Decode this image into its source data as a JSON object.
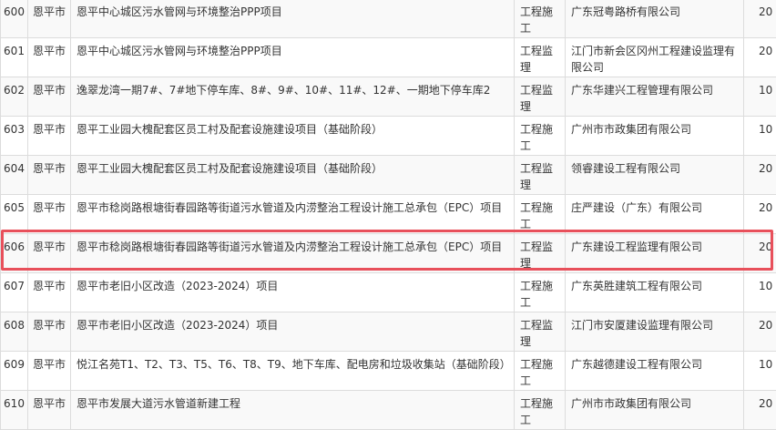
{
  "table": {
    "rows": [
      {
        "num": "600",
        "city": "恩平市",
        "project": "恩平中心城区污水管网与环境整治PPP项目",
        "type": "工程施工",
        "company": "广东冠粤路桥有限公司",
        "score": "20"
      },
      {
        "num": "601",
        "city": "恩平市",
        "project": "恩平中心城区污水管网与环境整治PPP项目",
        "type": "工程监理",
        "company": "江门市新会区冈州工程建设监理有限公司",
        "score": "20"
      },
      {
        "num": "602",
        "city": "恩平市",
        "project": "逸翠龙湾一期7#、7#地下停车库、8#、9#、10#、11#、12#、一期地下停车库2",
        "type": "工程监理",
        "company": "广东华建兴工程管理有限公司",
        "score": "10"
      },
      {
        "num": "603",
        "city": "恩平市",
        "project": "恩平工业园大槐配套区员工村及配套设施建设项目（基础阶段）",
        "type": "工程施工",
        "company": "广州市市政集团有限公司",
        "score": "10"
      },
      {
        "num": "604",
        "city": "恩平市",
        "project": "恩平工业园大槐配套区员工村及配套设施建设项目（基础阶段）",
        "type": "工程监理",
        "company": "领睿建设工程有限公司",
        "score": "20"
      },
      {
        "num": "605",
        "city": "恩平市",
        "project": "恩平市稔岗路根塘街春园路等街道污水管道及内涝整治工程设计施工总承包（EPC）项目",
        "type": "工程施工",
        "company": "庄严建设（广东）有限公司",
        "score": "20"
      },
      {
        "num": "606",
        "city": "恩平市",
        "project": "恩平市稔岗路根塘街春园路等街道污水管道及内涝整治工程设计施工总承包（EPC）项目",
        "type": "工程监理",
        "company": "广东建设工程监理有限公司",
        "score": "20"
      },
      {
        "num": "607",
        "city": "恩平市",
        "project": "恩平市老旧小区改造（2023-2024）项目",
        "type": "工程施工",
        "company": "广东英胜建筑工程有限公司",
        "score": "10"
      },
      {
        "num": "608",
        "city": "恩平市",
        "project": "恩平市老旧小区改造（2023-2024）项目",
        "type": "工程监理",
        "company": "江门市安厦建设监理有限公司",
        "score": "20"
      },
      {
        "num": "609",
        "city": "恩平市",
        "project": "悦江名苑T1、T2、T3、T5、T6、T8、T9、地下车库、配电房和垃圾收集站（基础阶段）",
        "type": "工程施工",
        "company": "广东越德建设工程有限公司",
        "score": "10"
      },
      {
        "num": "610",
        "city": "恩平市",
        "project": "恩平市发展大道污水管道新建工程",
        "type": "工程施工",
        "company": "广州市市政集团有限公司",
        "score": "20"
      }
    ]
  },
  "highlight_color": "#e8505b"
}
